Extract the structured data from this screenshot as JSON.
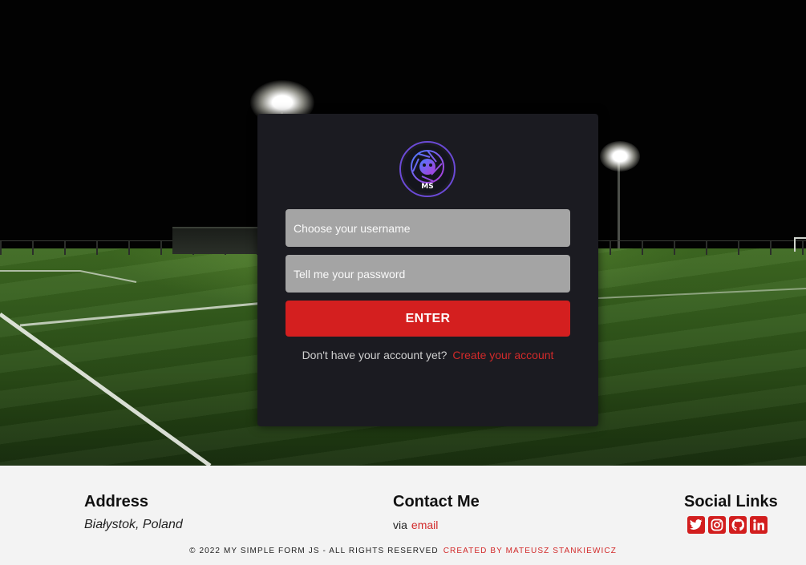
{
  "login": {
    "logo_text": "MS",
    "username_placeholder": "Choose your username",
    "password_placeholder": "Tell me your password",
    "enter_label": "ENTER",
    "signup_prompt": "Don't have your account yet?",
    "signup_link": "Create your account"
  },
  "footer": {
    "address_heading": "Address",
    "address_value": "Białystok, Poland",
    "contact_heading": "Contact Me",
    "contact_via": "via",
    "contact_link": "email",
    "social_heading": "Social Links",
    "social_icons": [
      "twitter-icon",
      "instagram-icon",
      "github-icon",
      "linkedin-icon"
    ],
    "copyright": "© 2022 MY SIMPLE FORM JS - ALL RIGHTS RESERVED",
    "credit": "CREATED BY MATEUSZ STANKIEWICZ"
  },
  "colors": {
    "accent": "#d41f1f",
    "card_bg": "#1b1b21",
    "input_bg": "#a4a4a4",
    "footer_bg": "#f3f3f3"
  }
}
